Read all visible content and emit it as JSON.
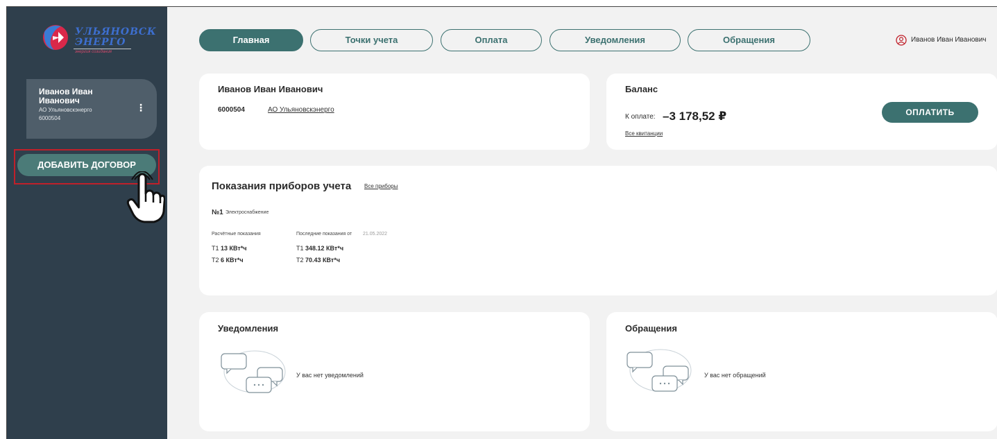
{
  "logo": {
    "line1": "УЛЬЯНОВСК",
    "line2": "ЭНЕРГО",
    "tagline": "энергия созидания"
  },
  "sidebar": {
    "account": {
      "name": "Иванов Иван Иванович",
      "org": "АО Ульяновскэнерго",
      "number": "6000504",
      "menu_icon": "kebab-menu-icon"
    },
    "add_contract_label": "ДОБАВИТЬ ДОГОВОР",
    "pointer_icon": "hand-pointer-icon"
  },
  "nav": {
    "tabs": [
      {
        "label": "Главная",
        "active": true
      },
      {
        "label": "Точки учета",
        "active": false
      },
      {
        "label": "Оплата",
        "active": false
      },
      {
        "label": "Уведомления",
        "active": false
      },
      {
        "label": "Обращения",
        "active": false
      }
    ],
    "user_name": "Иванов Иван Иванович",
    "user_icon": "user-circle-icon"
  },
  "account_card": {
    "name": "Иванов Иван Иванович",
    "number": "6000504",
    "org_link": "АО Ульяновскэнерго"
  },
  "balance": {
    "title": "Баланс",
    "to_pay_label": "К оплате:",
    "amount": "–3 178,52 ₽",
    "receipts_link": "Все квитанции",
    "pay_button": "ОПЛАТИТЬ"
  },
  "meters": {
    "title": "Показания приборов учета",
    "all_link": "Все приборы",
    "meter_no": "№1",
    "meter_type": "Электроснабжение",
    "calc_label": "Расчётные показания",
    "last_label": "Последние показания от",
    "last_date": "21.05.2022",
    "calc_t1_prefix": "Т1",
    "calc_t1_value": "13 КВт*ч",
    "calc_t2_prefix": "Т2",
    "calc_t2_value": "6 КВт*ч",
    "last_t1_prefix": "Т1",
    "last_t1_value": "348.12 КВт*ч",
    "last_t2_prefix": "Т2",
    "last_t2_value": "70.43 КВт*ч"
  },
  "notifications": {
    "title": "Уведомления",
    "empty_text": "У вас нет уведомлений",
    "icon": "chat-bubbles-icon"
  },
  "requests": {
    "title": "Обращения",
    "empty_text": "У вас нет обращений",
    "icon": "chat-bubbles-icon"
  },
  "colors": {
    "sidebar_bg": "#2f3f4c",
    "accent": "#3c7170",
    "page_bg": "#f2f2f2",
    "highlight_border": "#c0202a"
  }
}
